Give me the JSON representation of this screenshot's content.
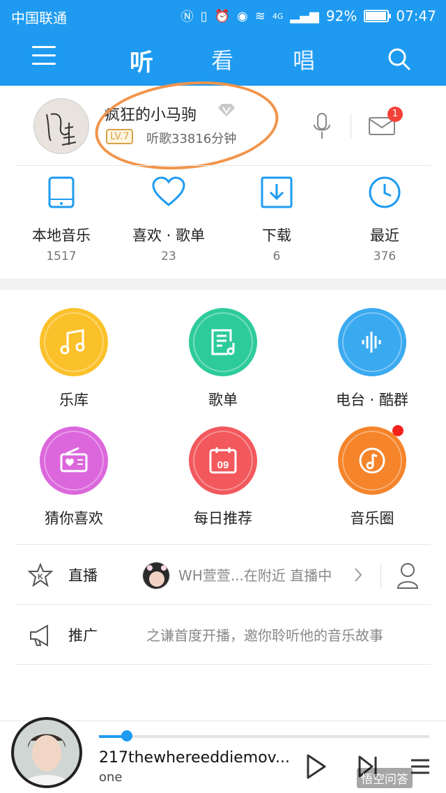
{
  "status_bar": {
    "carrier": "中国联通",
    "network": "4G",
    "battery": "92%",
    "time": "07:47"
  },
  "header": {
    "tabs": [
      {
        "label": "听",
        "active": true
      },
      {
        "label": "看",
        "active": false
      },
      {
        "label": "唱",
        "active": false
      }
    ],
    "bg_color": "#1e9bf0"
  },
  "profile": {
    "username": "疯狂的小马驹",
    "level": "LV.7",
    "listen_time": "听歌33816分钟",
    "mail_badge": "1"
  },
  "quick_access": [
    {
      "label": "本地音乐",
      "count": "1517",
      "icon": "phone-icon"
    },
    {
      "label": "喜欢 · 歌单",
      "count": "23",
      "icon": "heart-icon"
    },
    {
      "label": "下载",
      "count": "6",
      "icon": "download-icon"
    },
    {
      "label": "最近",
      "count": "376",
      "icon": "clock-icon"
    }
  ],
  "grid": [
    {
      "label": "乐库",
      "color": "#fbc12a",
      "icon": "music-note-icon"
    },
    {
      "label": "歌单",
      "color": "#2ecb9a",
      "icon": "playlist-icon"
    },
    {
      "label": "电台 · 酷群",
      "color": "#3aaaf0",
      "icon": "soundwave-icon"
    },
    {
      "label": "猜你喜欢",
      "color": "#dc67dc",
      "icon": "radio-heart-icon"
    },
    {
      "label": "每日推荐",
      "color": "#f2585c",
      "icon": "calendar-icon",
      "day": "09"
    },
    {
      "label": "音乐圈",
      "color": "#f5842a",
      "icon": "music-circle-icon",
      "dot": true
    }
  ],
  "live_row": {
    "title": "直播",
    "text": "WH萱萱...在附近 直播中"
  },
  "promo_row": {
    "title": "推广",
    "text": "之谦首度开播，邀你聆听他的音乐故事"
  },
  "player": {
    "title": "217thewhereeddiemov...",
    "artist": "one",
    "progress": 0.085
  },
  "watermark": "悟空问答"
}
